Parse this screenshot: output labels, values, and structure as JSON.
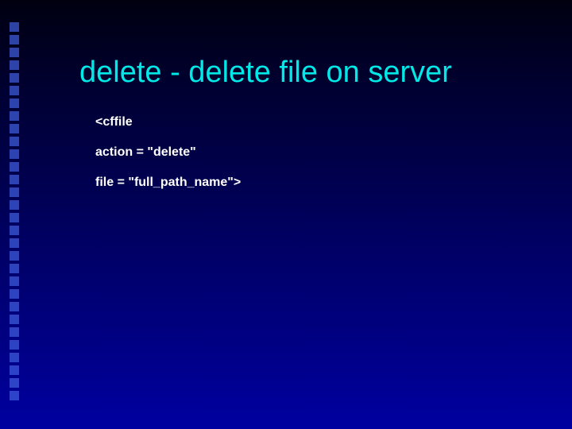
{
  "slide": {
    "title": "delete - delete file on server",
    "lines": [
      "<cffile",
      "action = \"delete\"",
      "file = \"full_path_name\">"
    ]
  }
}
